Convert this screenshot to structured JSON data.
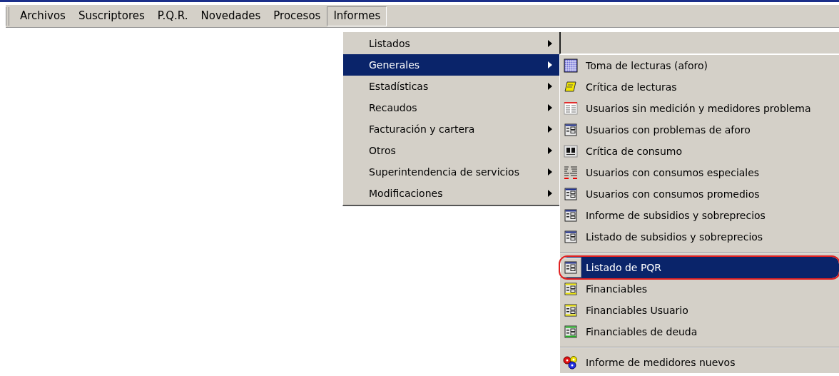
{
  "menubar": [
    {
      "label": "Archivos",
      "selected": false
    },
    {
      "label": "Suscriptores",
      "selected": false
    },
    {
      "label": "P.Q.R.",
      "selected": false
    },
    {
      "label": "Novedades",
      "selected": false
    },
    {
      "label": "Procesos",
      "selected": false
    },
    {
      "label": "Informes",
      "selected": true
    }
  ],
  "menu": [
    {
      "label": "Listados",
      "selected": false
    },
    {
      "label": "Generales",
      "selected": true
    },
    {
      "label": "Estadísticas",
      "selected": false
    },
    {
      "label": "Recaudos",
      "selected": false
    },
    {
      "label": "Facturación y cartera",
      "selected": false
    },
    {
      "label": "Otros",
      "selected": false
    },
    {
      "label": "Superintendencia de servicios",
      "selected": false
    },
    {
      "label": "Modificaciones",
      "selected": false
    }
  ],
  "submenu": [
    {
      "kind": "grid",
      "label": "Toma de lecturas (aforo)",
      "selected": false,
      "circled": false
    },
    {
      "kind": "scroll",
      "label": "Crítica de lecturas",
      "selected": false,
      "circled": false
    },
    {
      "kind": "list",
      "label": "Usuarios sin medición y medidores problema",
      "selected": false,
      "circled": false
    },
    {
      "kind": "form",
      "label": "Usuarios con problemas de aforo",
      "selected": false,
      "circled": false
    },
    {
      "kind": "columns",
      "label": "Crítica de consumo",
      "selected": false,
      "circled": false
    },
    {
      "kind": "special",
      "label": "Usuarios con consumos especiales",
      "selected": false,
      "circled": false
    },
    {
      "kind": "form",
      "label": "Usuarios con consumos promedios",
      "selected": false,
      "circled": false
    },
    {
      "kind": "form",
      "label": "Informe de subsidios y sobreprecios",
      "selected": false,
      "circled": false
    },
    {
      "kind": "form",
      "label": "Listado de subsidios y sobreprecios",
      "selected": false,
      "circled": false
    },
    {
      "kind": "separator"
    },
    {
      "kind": "form",
      "label": "Listado de PQR",
      "selected": true,
      "circled": true
    },
    {
      "kind": "form-yellow",
      "label": "Financiables",
      "selected": false,
      "circled": false
    },
    {
      "kind": "form-yellow",
      "label": "Financiables Usuario",
      "selected": false,
      "circled": false
    },
    {
      "kind": "form-green",
      "label": "Financiables de deuda",
      "selected": false,
      "circled": false
    },
    {
      "kind": "separator"
    },
    {
      "kind": "gears",
      "label": "Informe de medidores nuevos",
      "selected": false,
      "circled": false
    }
  ]
}
